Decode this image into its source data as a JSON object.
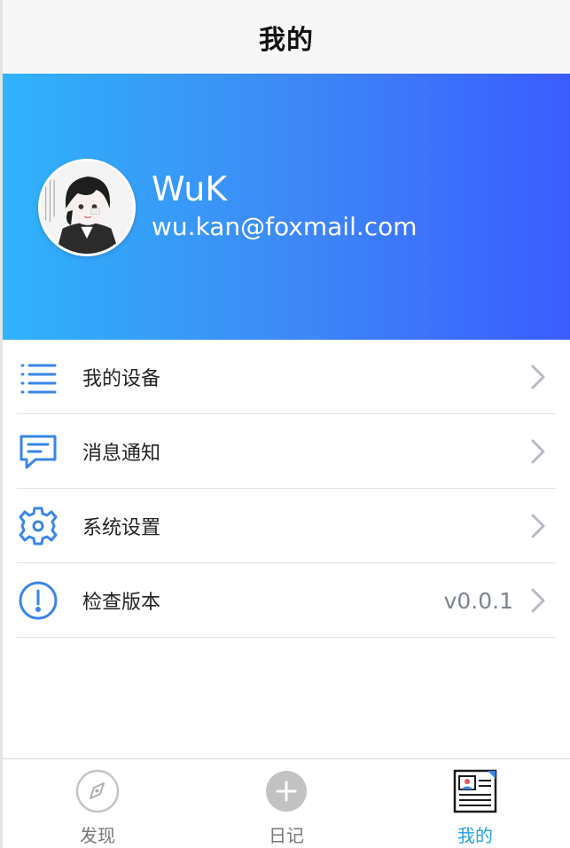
{
  "navbar": {
    "title": "我的"
  },
  "profile": {
    "name": "WuK",
    "email": "wu.kan@foxmail.com",
    "gradient_start": "#2fb3fb",
    "gradient_end": "#3a5cff"
  },
  "menu": {
    "items": [
      {
        "label": "我的设备",
        "icon": "list-icon",
        "value": ""
      },
      {
        "label": "消息通知",
        "icon": "message-icon",
        "value": ""
      },
      {
        "label": "系统设置",
        "icon": "gear-icon",
        "value": ""
      },
      {
        "label": "检查版本",
        "icon": "info-icon",
        "value": "v0.0.1"
      }
    ],
    "icon_color": "#3a86e6"
  },
  "tabbar": {
    "tabs": [
      {
        "label": "发现",
        "icon": "compass-icon",
        "active": false
      },
      {
        "label": "日记",
        "icon": "add-icon",
        "active": false
      },
      {
        "label": "我的",
        "icon": "profile-card-icon",
        "active": true
      }
    ],
    "active_color": "#26a3e0"
  }
}
